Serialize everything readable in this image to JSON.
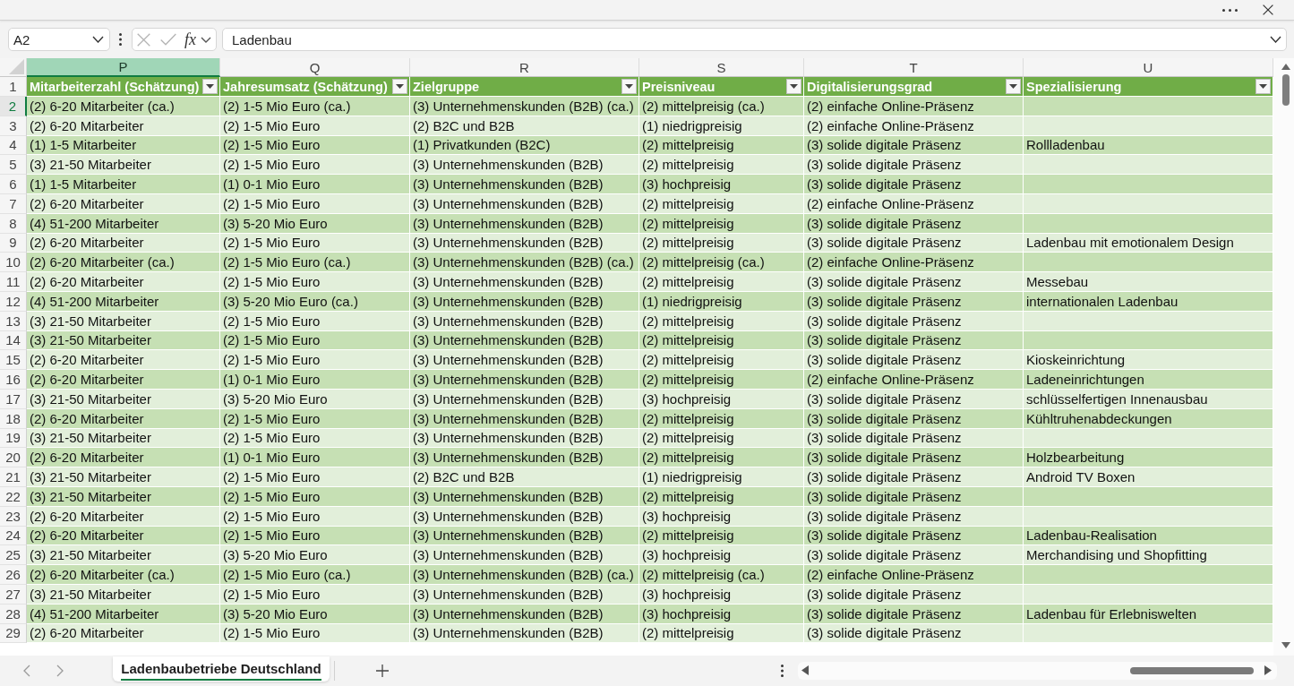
{
  "formula_bar": {
    "name_box": "A2",
    "edit_buttons": [
      {
        "kind": "cancel",
        "disabled": true
      },
      {
        "kind": "confirm",
        "disabled": true
      }
    ],
    "function_button": "fx",
    "formula": "Ladenbau"
  },
  "sheet": {
    "columns": [
      {
        "letter": "P",
        "selected": true,
        "heading": "Mitarbeiterzahl (Schätzung)"
      },
      {
        "letter": "Q",
        "selected": false,
        "heading": "Jahresumsatz (Schätzung)"
      },
      {
        "letter": "R",
        "selected": false,
        "heading": "Zielgruppe"
      },
      {
        "letter": "S",
        "selected": false,
        "heading": "Preisniveau"
      },
      {
        "letter": "T",
        "selected": false,
        "heading": "Digitalisierungsgrad"
      },
      {
        "letter": "U",
        "selected": false,
        "heading": "Spezialisierung"
      }
    ],
    "header_row": {
      "number": "1",
      "selected": false
    },
    "rows": [
      {
        "number": "2",
        "selected": true,
        "cells": [
          "(2) 6-20 Mitarbeiter (ca.)",
          "(2) 1-5 Mio Euro (ca.)",
          "(3) Unternehmenskunden (B2B) (ca.)",
          "(2) mittelpreisig (ca.)",
          "(2) einfache Online-Präsenz"
        ]
      },
      {
        "number": "3",
        "selected": false,
        "cells": [
          "(2) 6-20 Mitarbeiter",
          "(2) 1-5 Mio Euro",
          "(2) B2C und B2B",
          "(1) niedrigpreisig",
          "(2) einfache Online-Präsenz"
        ]
      },
      {
        "number": "4",
        "selected": false,
        "cells": [
          "(1) 1-5 Mitarbeiter",
          "(2) 1-5 Mio Euro",
          "(1) Privatkunden (B2C)",
          "(2) mittelpreisig",
          "(3) solide digitale Präsenz",
          "Rollladenbau"
        ]
      },
      {
        "number": "5",
        "selected": false,
        "cells": [
          "(3) 21-50 Mitarbeiter",
          "(2) 1-5 Mio Euro",
          "(3) Unternehmenskunden (B2B)",
          "(2) mittelpreisig",
          "(3) solide digitale Präsenz"
        ]
      },
      {
        "number": "6",
        "selected": false,
        "cells": [
          "(1) 1-5 Mitarbeiter",
          "(1) 0-1 Mio Euro",
          "(3) Unternehmenskunden (B2B)",
          "(3) hochpreisig",
          "(3) solide digitale Präsenz"
        ]
      },
      {
        "number": "7",
        "selected": false,
        "cells": [
          "(2) 6-20 Mitarbeiter",
          "(2) 1-5 Mio Euro",
          "(3) Unternehmenskunden (B2B)",
          "(2) mittelpreisig",
          "(2) einfache Online-Präsenz"
        ]
      },
      {
        "number": "8",
        "selected": false,
        "cells": [
          "(4) 51-200 Mitarbeiter",
          "(3) 5-20 Mio Euro",
          "(3) Unternehmenskunden (B2B)",
          "(2) mittelpreisig",
          "(3) solide digitale Präsenz"
        ]
      },
      {
        "number": "9",
        "selected": false,
        "cells": [
          "(2) 6-20 Mitarbeiter",
          "(2) 1-5 Mio Euro",
          "(3) Unternehmenskunden (B2B)",
          "(2) mittelpreisig",
          "(3) solide digitale Präsenz",
          "Ladenbau mit emotionalem Design"
        ]
      },
      {
        "number": "10",
        "selected": false,
        "cells": [
          "(2) 6-20 Mitarbeiter (ca.)",
          "(2) 1-5 Mio Euro (ca.)",
          "(3) Unternehmenskunden (B2B) (ca.)",
          "(2) mittelpreisig (ca.)",
          "(2) einfache Online-Präsenz"
        ]
      },
      {
        "number": "11",
        "selected": false,
        "cells": [
          "(2) 6-20 Mitarbeiter",
          "(2) 1-5 Mio Euro",
          "(3) Unternehmenskunden (B2B)",
          "(2) mittelpreisig",
          "(3) solide digitale Präsenz",
          "Messebau"
        ]
      },
      {
        "number": "12",
        "selected": false,
        "cells": [
          "(4) 51-200 Mitarbeiter",
          "(3) 5-20 Mio Euro (ca.)",
          "(3) Unternehmenskunden (B2B)",
          "(1) niedrigpreisig",
          "(3) solide digitale Präsenz",
          "internationalen Ladenbau"
        ]
      },
      {
        "number": "13",
        "selected": false,
        "cells": [
          "(3) 21-50 Mitarbeiter",
          "(2) 1-5 Mio Euro",
          "(3) Unternehmenskunden (B2B)",
          "(2) mittelpreisig",
          "(3) solide digitale Präsenz"
        ]
      },
      {
        "number": "14",
        "selected": false,
        "cells": [
          "(3) 21-50 Mitarbeiter",
          "(2) 1-5 Mio Euro",
          "(3) Unternehmenskunden (B2B)",
          "(2) mittelpreisig",
          "(3) solide digitale Präsenz"
        ]
      },
      {
        "number": "15",
        "selected": false,
        "cells": [
          "(2) 6-20 Mitarbeiter",
          "(2) 1-5 Mio Euro",
          "(3) Unternehmenskunden (B2B)",
          "(2) mittelpreisig",
          "(3) solide digitale Präsenz",
          "Kioskeinrichtung"
        ]
      },
      {
        "number": "16",
        "selected": false,
        "cells": [
          "(2) 6-20 Mitarbeiter",
          "(1) 0-1 Mio Euro",
          "(3) Unternehmenskunden (B2B)",
          "(2) mittelpreisig",
          "(2) einfache Online-Präsenz",
          "Ladeneinrichtungen"
        ]
      },
      {
        "number": "17",
        "selected": false,
        "cells": [
          "(3) 21-50 Mitarbeiter",
          "(3) 5-20 Mio Euro",
          "(3) Unternehmenskunden (B2B)",
          "(3) hochpreisig",
          "(3) solide digitale Präsenz",
          "schlüsselfertigen Innenausbau"
        ]
      },
      {
        "number": "18",
        "selected": false,
        "cells": [
          "(2) 6-20 Mitarbeiter",
          "(2) 1-5 Mio Euro",
          "(3) Unternehmenskunden (B2B)",
          "(2) mittelpreisig",
          "(3) solide digitale Präsenz",
          "Kühltruhenabdeckungen"
        ]
      },
      {
        "number": "19",
        "selected": false,
        "cells": [
          "(3) 21-50 Mitarbeiter",
          "(2) 1-5 Mio Euro",
          "(3) Unternehmenskunden (B2B)",
          "(2) mittelpreisig",
          "(3) solide digitale Präsenz"
        ]
      },
      {
        "number": "20",
        "selected": false,
        "cells": [
          "(2) 6-20 Mitarbeiter",
          "(1) 0-1 Mio Euro",
          "(3) Unternehmenskunden (B2B)",
          "(2) mittelpreisig",
          "(3) solide digitale Präsenz",
          "Holzbearbeitung"
        ]
      },
      {
        "number": "21",
        "selected": false,
        "cells": [
          "(3) 21-50 Mitarbeiter",
          "(2) 1-5 Mio Euro",
          "(2) B2C und B2B",
          "(1) niedrigpreisig",
          "(3) solide digitale Präsenz",
          "Android TV Boxen"
        ]
      },
      {
        "number": "22",
        "selected": false,
        "cells": [
          "(3) 21-50 Mitarbeiter",
          "(2) 1-5 Mio Euro",
          "(3) Unternehmenskunden (B2B)",
          "(2) mittelpreisig",
          "(3) solide digitale Präsenz"
        ]
      },
      {
        "number": "23",
        "selected": false,
        "cells": [
          "(2) 6-20 Mitarbeiter",
          "(2) 1-5 Mio Euro",
          "(3) Unternehmenskunden (B2B)",
          "(3) hochpreisig",
          "(3) solide digitale Präsenz"
        ]
      },
      {
        "number": "24",
        "selected": false,
        "cells": [
          "(2) 6-20 Mitarbeiter",
          "(2) 1-5 Mio Euro",
          "(3) Unternehmenskunden (B2B)",
          "(2) mittelpreisig",
          "(3) solide digitale Präsenz",
          "Ladenbau-Realisation"
        ]
      },
      {
        "number": "25",
        "selected": false,
        "cells": [
          "(3) 21-50 Mitarbeiter",
          "(3) 5-20 Mio Euro",
          "(3) Unternehmenskunden (B2B)",
          "(3) hochpreisig",
          "(3) solide digitale Präsenz",
          "Merchandising und Shopfitting"
        ]
      },
      {
        "number": "26",
        "selected": false,
        "cells": [
          "(2) 6-20 Mitarbeiter (ca.)",
          "(2) 1-5 Mio Euro (ca.)",
          "(3) Unternehmenskunden (B2B) (ca.)",
          "(2) mittelpreisig (ca.)",
          "(2) einfache Online-Präsenz"
        ]
      },
      {
        "number": "27",
        "selected": false,
        "cells": [
          "(3) 21-50 Mitarbeiter",
          "(2) 1-5 Mio Euro",
          "(3) Unternehmenskunden (B2B)",
          "(3) hochpreisig",
          "(3) solide digitale Präsenz"
        ]
      },
      {
        "number": "28",
        "selected": false,
        "cells": [
          "(4) 51-200 Mitarbeiter",
          "(3) 5-20 Mio Euro",
          "(3) Unternehmenskunden (B2B)",
          "(3) hochpreisig",
          "(3) solide digitale Präsenz",
          "Ladenbau für Erlebniswelten"
        ]
      },
      {
        "number": "29",
        "selected": false,
        "cells": [
          "(2) 6-20 Mitarbeiter",
          "(2) 1-5 Mio Euro",
          "(3) Unternehmenskunden (B2B)",
          "(2) mittelpreisig",
          "(3) solide digitale Präsenz"
        ]
      }
    ]
  },
  "sheet_tabs": [
    {
      "label": "Ladenbaubetriebe Deutschland",
      "selected": true
    }
  ]
}
